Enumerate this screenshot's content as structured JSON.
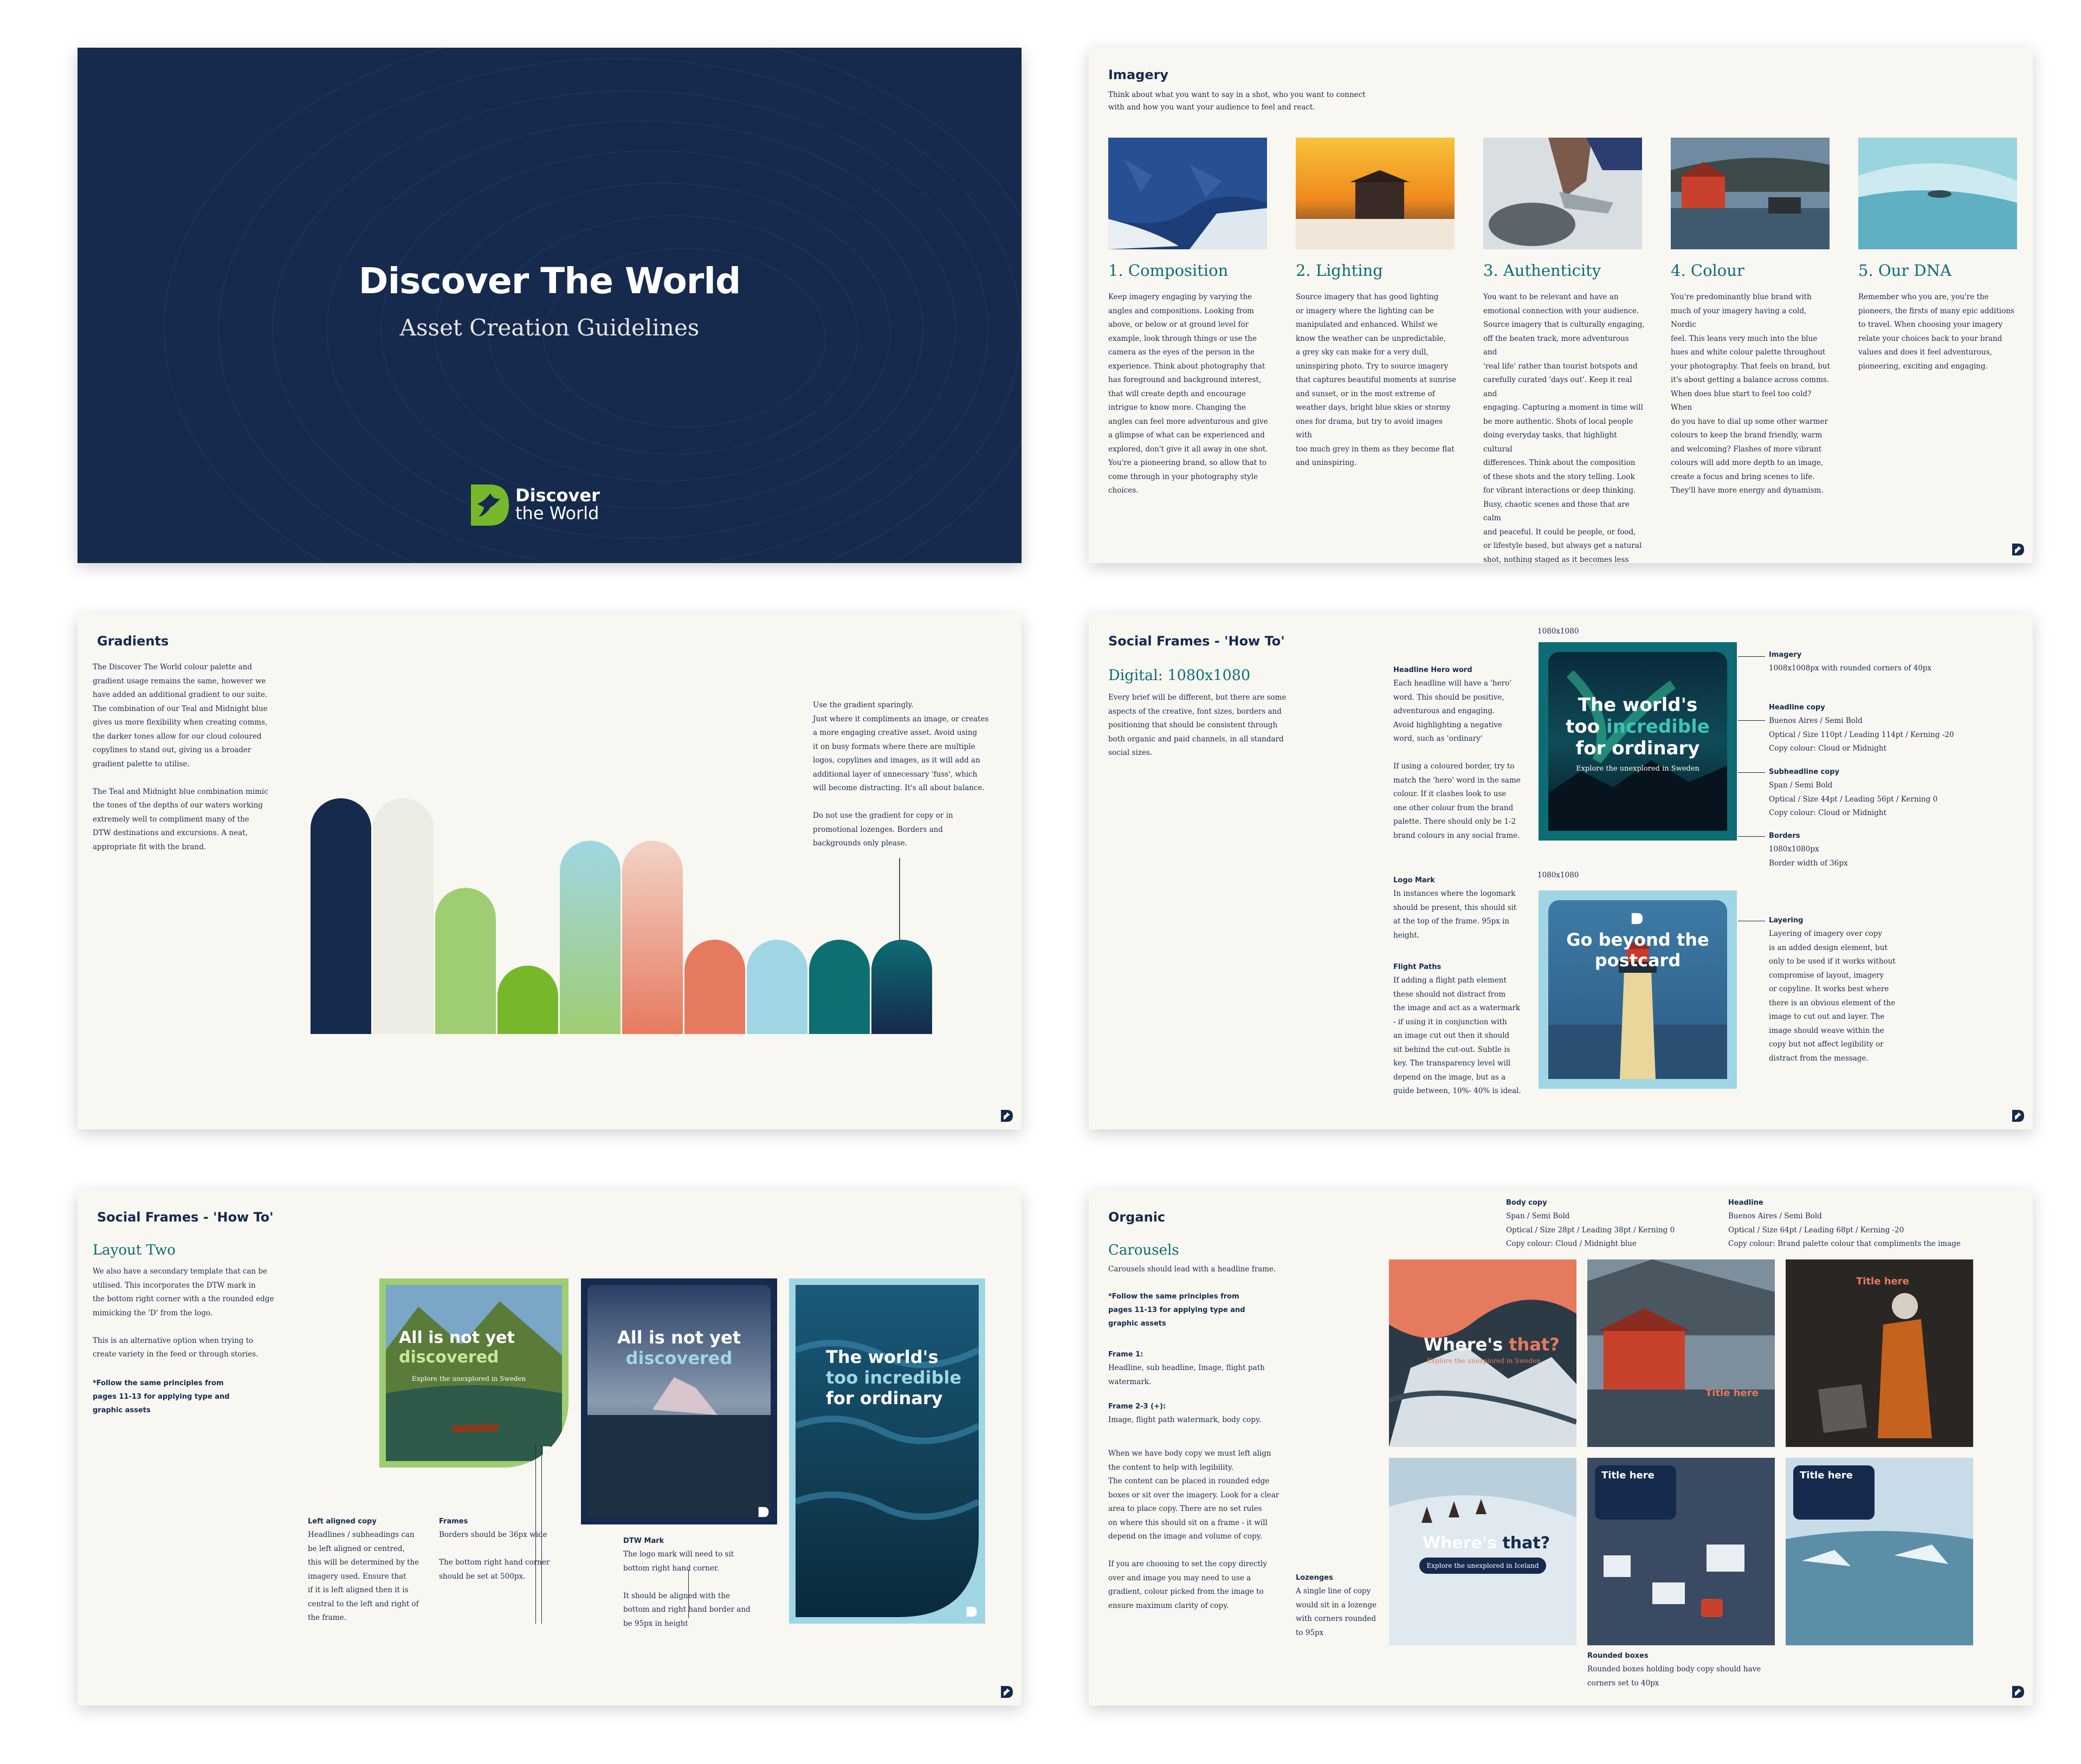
{
  "cover": {
    "title": "Discover The World",
    "subtitle": "Asset Creation Guidelines",
    "logo_line1": "Discover",
    "logo_line2": "the World"
  },
  "imagery": {
    "title": "Imagery",
    "intro": "Think about what you want to say in a shot, who you want to connect\nwith and how you want your audience to feel and react.",
    "columns": [
      {
        "heading": "1. Composition",
        "body": "Keep imagery engaging by varying the\nangles and compositions. Looking from\nabove, or below or at ground level for\nexample, look through things or use the\ncamera as the eyes of the person in the\nexperience. Think about photography that\nhas foreground and background interest,\nthat will create depth and encourage\nintrigue to know more. Changing the\nangles can feel more adventurous and give\na glimpse of what can be experienced and\nexplored, don't give it all away in one shot.\nYou're a pioneering brand, so allow that to\ncome through in your photography style\nchoices."
      },
      {
        "heading": "2. Lighting",
        "body": "Source imagery that has good lighting\nor imagery where the lighting can be\nmanipulated and enhanced. Whilst we\nknow the weather can be unpredictable,\na grey sky can make for a very dull,\nuninspiring photo. Try to source imagery\nthat captures beautiful moments at sunrise\nand sunset, or in the most extreme of\nweather days, bright blue skies or stormy\nones for drama, but try to avoid images with\ntoo much grey in them as they become flat\nand uninspiring."
      },
      {
        "heading": "3. Authenticity",
        "body": "You want to be relevant and have an\nemotional connection with your audience.\nSource imagery that is culturally engaging,\noff the beaten track, more adventurous and\n'real life' rather than tourist hotspots and\ncarefully curated 'days out'. Keep it real and\nengaging. Capturing a moment in time will\nbe more authentic. Shots of local people\ndoing everyday tasks, that highlight cultural\ndifferences. Think about the composition\nof these shots and the story telling. Look\nfor vibrant interactions or deep thinking.\nBusy, chaotic scenes and those that are calm\nand peaceful. It could be people, or food,\nor lifestyle based, but always get a natural\nshot, nothing staged as it becomes less\nbelievable. Diversity and being inclusive\nare paramount."
      },
      {
        "heading": "4. Colour",
        "body": "You're predominantly blue brand with\nmuch of your imagery having a cold, Nordic\nfeel. This leans very much into the blue\nhues and white colour palette throughout\nyour photography. That feels on brand, but\nit's about getting a balance across comms.\nWhen does blue start to feel too cold? When\ndo you have to dial up some other warmer\ncolours to keep the brand friendly, warm\nand welcoming? Flashes of more vibrant\ncolours will add more depth to an image,\ncreate a focus and bring scenes to life.\nThey'll have more energy and dynamism."
      },
      {
        "heading": "5. Our DNA",
        "body": "Remember who you are, you're the\npioneers, the firsts of many epic additions\nto travel. When choosing your imagery\nrelate your choices back to your brand\nvalues and does it feel adventurous,\npioneering, exciting and engaging."
      }
    ]
  },
  "gradients": {
    "title": "Gradients",
    "left_text": "The Discover The World colour palette and\ngradient usage remains the same, however we\nhave added an additional gradient to our suite.\nThe combination of our Teal and Midnight blue\ngives us more flexibility when creating comms,\nthe darker tones allow for our cloud coloured\ncopylines to stand out, giving us a broader\ngradient palette to utilise.\n\nThe Teal and Midnight blue combination mimic\nthe tones of the depths of our waters working\nextremely well to compliment many of the\nDTW destinations and excursions. A neat,\nappropriate fit with the brand.",
    "right_text": "Use the gradient sparingly.\nJust where it compliments an image, or creates\na more engaging creative asset. Avoid using\nit on busy formats where there are multiple\nlogos, copylines and images, as it will add an\nadditional layer of unnecessary 'fuss', which\nwill become distracting. It's all about balance.\n\nDo not use the gradient for copy or in\npromotional lozenges. Borders and\nbackgrounds only please.",
    "swatches": [
      {
        "name": "midnight",
        "top": "#152a4d",
        "bottom": "#152a4d",
        "level": 1.0
      },
      {
        "name": "cloud",
        "top": "#ecebe4",
        "bottom": "#ecebe4",
        "level": 1.0
      },
      {
        "name": "light-green",
        "top": "#9fcd72",
        "bottom": "#9fcd72",
        "level": 0.62
      },
      {
        "name": "green",
        "top": "#76b82a",
        "bottom": "#76b82a",
        "level": 0.29
      },
      {
        "name": "sky-to-green-gradient",
        "top": "#a0d6e4",
        "bottom": "#9fcd72",
        "level": 0.82
      },
      {
        "name": "peach-to-coral-gradient",
        "top": "#f2d3c6",
        "bottom": "#e67a5f",
        "level": 0.82
      },
      {
        "name": "coral",
        "top": "#e67a5f",
        "bottom": "#e67a5f",
        "level": 0.4
      },
      {
        "name": "sky",
        "top": "#a0d6e4",
        "bottom": "#a0d6e4",
        "level": 0.4
      },
      {
        "name": "teal",
        "top": "#0e6f72",
        "bottom": "#0e6f72",
        "level": 0.4
      },
      {
        "name": "teal-to-midnight-gradient",
        "top": "#0d6c74",
        "bottom": "#152a4d",
        "level": 0.4
      }
    ]
  },
  "social_how_to": {
    "title": "Social Frames - 'How To'",
    "subheading": "Digital: 1080x1080",
    "intro": "Every brief will be different, but there are some\naspects of the creative, font sizes, borders and\npositioning that should be consistent through\nboth organic and paid channels, in all standard\nsocial sizes.",
    "size_label_1": "1080x1080",
    "size_label_2": "1080x1080",
    "headline_hero_label": "Headline Hero word",
    "headline_hero_text": "Each headline will have a 'hero'\nword. This should be positive,\nadventurous and engaging.\nAvoid highlighting a negative\nword, such as 'ordinary'\n\nIf using a coloured border, try to\nmatch the 'hero' word in the same\ncolour. If it clashes look to use\none other colour from the brand\npalette. There should only be 1-2\nbrand colours in any social frame.",
    "logo_mark_label": "Logo Mark",
    "logo_mark_text": "In instances where the logomark\nshould be present, this should sit\nat the top of the frame. 95px in\nheight.",
    "flight_paths_label": "Flight Paths",
    "flight_paths_text": "If adding a flight path element\nthese should not distract from\nthe image and act as a watermark\n- if using it in conjunction with\nan image cut out then it should\nsit behind the cut-out. Subtle is\nkey. The transparency level will\ndepend on the image, but as a\nguide between, 10%- 40% is ideal.",
    "imagery_label": "Imagery",
    "imagery_text": "1008x1008px with rounded corners of 40px",
    "headline_copy_label": "Headline copy",
    "headline_copy_text": "Buenos Aires / Semi Bold\nOptical / Size 110pt / Leading 114pt / Kerning -20\nCopy colour: Cloud or Midnight",
    "subheadline_copy_label": "Subheadline copy",
    "subheadline_copy_text": "Span / Semi Bold\nOptical / Size 44pt / Leading 56pt / Kerning 0\nCopy colour: Cloud or Midnight",
    "borders_label": "Borders",
    "borders_text": "1080x1080px\nBorder width of 36px",
    "layering_label": "Layering",
    "layering_text": "Layering of imagery over copy\nis an added design element, but\nonly to be used if it works without\ncompromise of layout, imagery\nor copyline. It works best where\nthere is an obvious element of the\nimage to cut out and layer. The\nimage should weave within the\ncopy but not affect legibility or\ndistract from the message.",
    "frame1_line1": "The world's",
    "frame1_line2a": "too ",
    "frame1_hero": "incredible",
    "frame1_line3": "for ordinary",
    "frame1_sub": "Explore the unexplored in Sweden",
    "frame2_line1": "Go beyond the",
    "frame2_line2": "postcard"
  },
  "layout_two": {
    "title": "Social Frames - 'How To'",
    "subheading": "Layout Two",
    "intro": "We also have a secondary template that can be\nutilised. This incorporates the DTW mark in\nthe bottom right corner with a the rounded edge\nmimicking the 'D' from the logo.\n\nThis is an alternative option when trying to\ncreate variety in the feed or through stories.",
    "follow_note": "*Follow the same principles from\npages 11-13 for applying type and\ngraphic assets",
    "left_aligned_label": "Left aligned copy",
    "left_aligned_text": "Headlines / subheadings can\nbe left aligned or centred,\nthis will be determined by the\nimagery used. Ensure that\nif it is left aligned then it is\ncentral to the left and right of\nthe frame.",
    "frames_label": "Frames",
    "frames_text": "Borders should be 36px wide\n\nThe bottom right hand corner\nshould be set at 500px.",
    "dtw_mark_label": "DTW Mark",
    "dtw_mark_text": "The logo mark will need to sit\nbottom right hand corner.\n\nIt should be aligned with the\nbottom and right hand border and\nbe 95px in height",
    "card1_line1": "All is not yet",
    "card1_hero": "discovered",
    "card1_sub": "Explore the unexplored in Sweden",
    "card2_line1": "All is not yet",
    "card2_hero": "discovered",
    "card3_line1": "The world's",
    "card3_line2": "too incredible",
    "card3_line3": "for ordinary"
  },
  "organic": {
    "title": "Organic",
    "subheading": "Carousels",
    "intro": "Carousels should lead with a headline frame.",
    "follow_note": "*Follow the same principles from\npages 11-13 for applying type and\ngraphic assets",
    "frame1_label": "Frame 1:",
    "frame1_text": "Headline, sub headline, Image, flight path\nwatermark.",
    "frame23_label": "Frame 2-3 (+):",
    "frame23_text": "Image, flight path watermark, body copy.",
    "body_text": "When we have body copy we must left align\nthe content to help with legibility.\nThe content can be placed in rounded edge\nboxes or sit over the imagery. Look for a clear\narea to place copy. There are no set rules\non where this should sit on a frame - it will\ndepend on the image and volume of copy.\n\nIf you are choosing to set the copy directly\nover and image you may need to use a\ngradient, colour picked from the image to\nensure maximum clarity of copy.",
    "body_copy_label": "Body copy",
    "body_copy_text": "Span / Semi Bold\nOptical / Size 28pt / Leading 38pt / Kerning 0\nCopy colour: Cloud / Midnight blue",
    "headline_label": "Headline",
    "headline_text": "Buenos Aires / Semi Bold\nOptical / Size 64pt / Leading 68pt / Kerning -20\nCopy colour: Brand palette colour that compliments the image",
    "lozenges_label": "Lozenges",
    "lozenges_text": "A single line of copy\nwould sit in a lozenge\nwith corners rounded\nto 95px",
    "rounded_boxes_label": "Rounded boxes",
    "rounded_boxes_text": "Rounded boxes holding body copy should have\ncorners set to 40px",
    "tile_where": "Where's",
    "tile_that": "that?",
    "tile_sub": "Explore the unexplored in Sweden",
    "tile_title_here": "Title here",
    "tile_lozenge": "Explore the unexplored in Iceland"
  }
}
